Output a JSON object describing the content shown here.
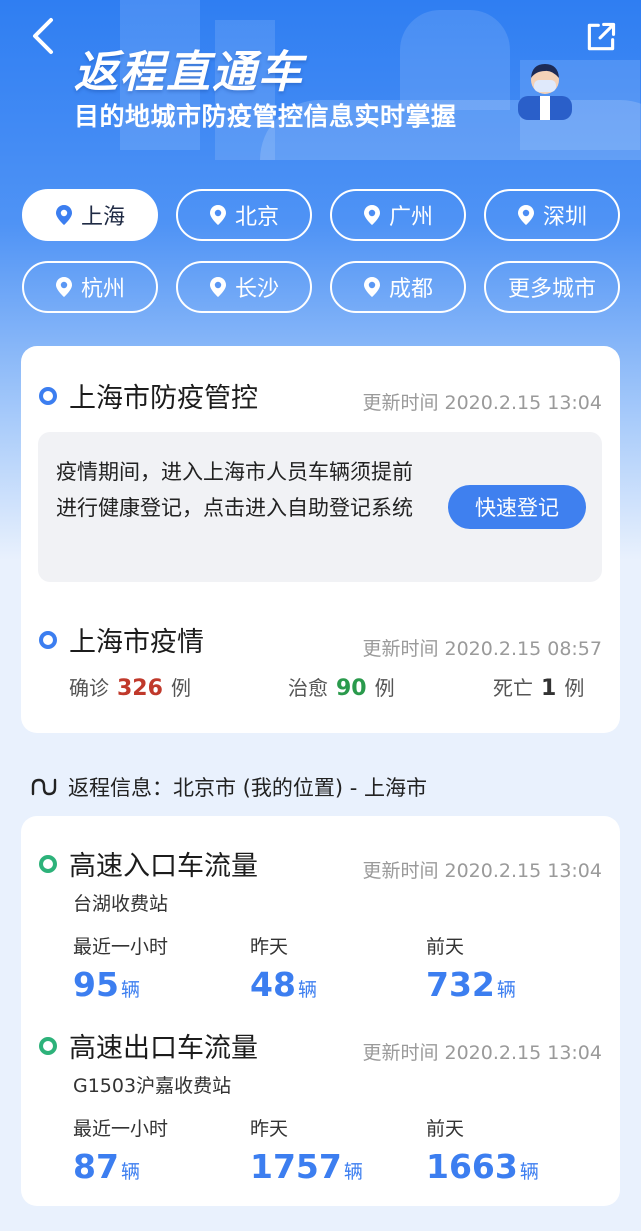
{
  "header": {
    "title": "返程直通车",
    "subtitle": "目的地城市防疫管控信息实时掌握"
  },
  "cities": {
    "items": [
      "上海",
      "北京",
      "广州",
      "深圳",
      "杭州",
      "长沙",
      "成都"
    ],
    "selected": "上海",
    "more_label": "更多城市"
  },
  "control": {
    "title": "上海市防疫管控",
    "updated": "更新时间 2020.2.15 13:04",
    "notice": "疫情期间，进入上海市人员车辆须提前进行健康登记，点击进入自助登记系统",
    "button_label": "快速登记"
  },
  "epidemic": {
    "title": "上海市疫情",
    "updated": "更新时间 2020.2.15 08:57",
    "confirmed_label": "确诊",
    "confirmed": "326",
    "cured_label": "治愈",
    "cured": "90",
    "death_label": "死亡",
    "death": "1",
    "unit": "例"
  },
  "route": {
    "text": "返程信息：北京市 (我的位置) - 上海市"
  },
  "entry": {
    "title": "高速入口车流量",
    "updated": "更新时间 2020.2.15 13:04",
    "station": "台湖收费站",
    "labels": [
      "最近一小时",
      "昨天",
      "前天"
    ],
    "values": [
      "95",
      "48",
      "732"
    ],
    "unit": "辆"
  },
  "exit": {
    "title": "高速出口车流量",
    "updated": "更新时间 2020.2.15 13:04",
    "station": "G1503沪嘉收费站",
    "labels": [
      "最近一小时",
      "昨天",
      "前天"
    ],
    "values": [
      "87",
      "1757",
      "1663"
    ],
    "unit": "辆"
  },
  "colors": {
    "primary": "#3c7ef0",
    "confirmed": "#c0392b",
    "cured": "#2a9a4c",
    "flow_dot": "#2db27a"
  }
}
